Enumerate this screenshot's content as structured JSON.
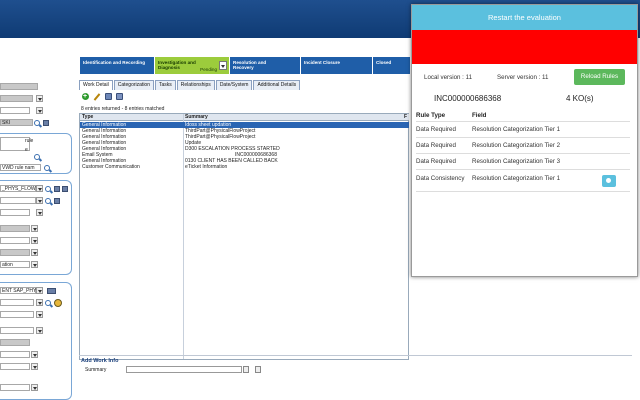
{
  "left_panel": {
    "field_texts": [
      "SKI",
      "rule",
      "e",
      "VWD rule nam",
      "_PHYS_FLOW",
      "ation",
      "ENT SAP_PHY"
    ]
  },
  "process_steps": [
    {
      "label": "Identification and Recording"
    },
    {
      "label": "Investigation and Diagnosis",
      "status": "Pending"
    },
    {
      "label": "Resolution and Recovery"
    },
    {
      "label": "Incident Closure"
    },
    {
      "label": "Closed"
    }
  ],
  "tabs": [
    "Work Detail",
    "Categorization",
    "Tasks",
    "Relationships",
    "Date/System",
    "Additional Details"
  ],
  "entries_text": "8 entries returned - 8 entries matched",
  "grid": {
    "headers": {
      "type": "Type",
      "summary": "Summary",
      "f": "F"
    },
    "rows": [
      {
        "type": "General Information",
        "summary": "Idoss sheet updation"
      },
      {
        "type": "General Information",
        "summary": "ThirdPart@PhysicalFlowProject"
      },
      {
        "type": "General Information",
        "summary": "ThirdPart@PhysicalFlowProject"
      },
      {
        "type": "General Information",
        "summary": "Update"
      },
      {
        "type": "General Information",
        "summary": "D300 ESCALATION PROCESS STARTED"
      },
      {
        "type": "Email System",
        "summary": "INC000000686368"
      },
      {
        "type": "General Information",
        "summary": "0130 CLIENT HAS BEEN CALLED BACK"
      },
      {
        "type": "Customer Communication",
        "summary": "eTicket Information"
      }
    ]
  },
  "add_work_info": {
    "title": "Add Work Info",
    "summary_label": "Summary"
  },
  "overlay": {
    "restart_label": "Restart the evaluation",
    "local_version": "Local version : 11",
    "server_version": "Server version : 11",
    "reload_label": "Reload Rules",
    "incident_number": "INC000000686368",
    "ko_count": "4 KO(s)",
    "headers": {
      "rule_type": "Rule Type",
      "field": "Field"
    },
    "rules": [
      {
        "rule_type": "Data Required",
        "field": "Resolution Categorization Tier 1"
      },
      {
        "rule_type": "Data Required",
        "field": "Resolution Categorization Tier 2"
      },
      {
        "rule_type": "Data Required",
        "field": "Resolution Categorization Tier 3"
      },
      {
        "rule_type": "Data Consistency",
        "field": "Resolution Categorization Tier 1"
      }
    ]
  },
  "colors": {
    "header": "#1f4f8e",
    "restart": "#5bc0de",
    "alert": "#ff0000",
    "reload": "#5cb85c",
    "active_step": "#9ccc3c"
  }
}
